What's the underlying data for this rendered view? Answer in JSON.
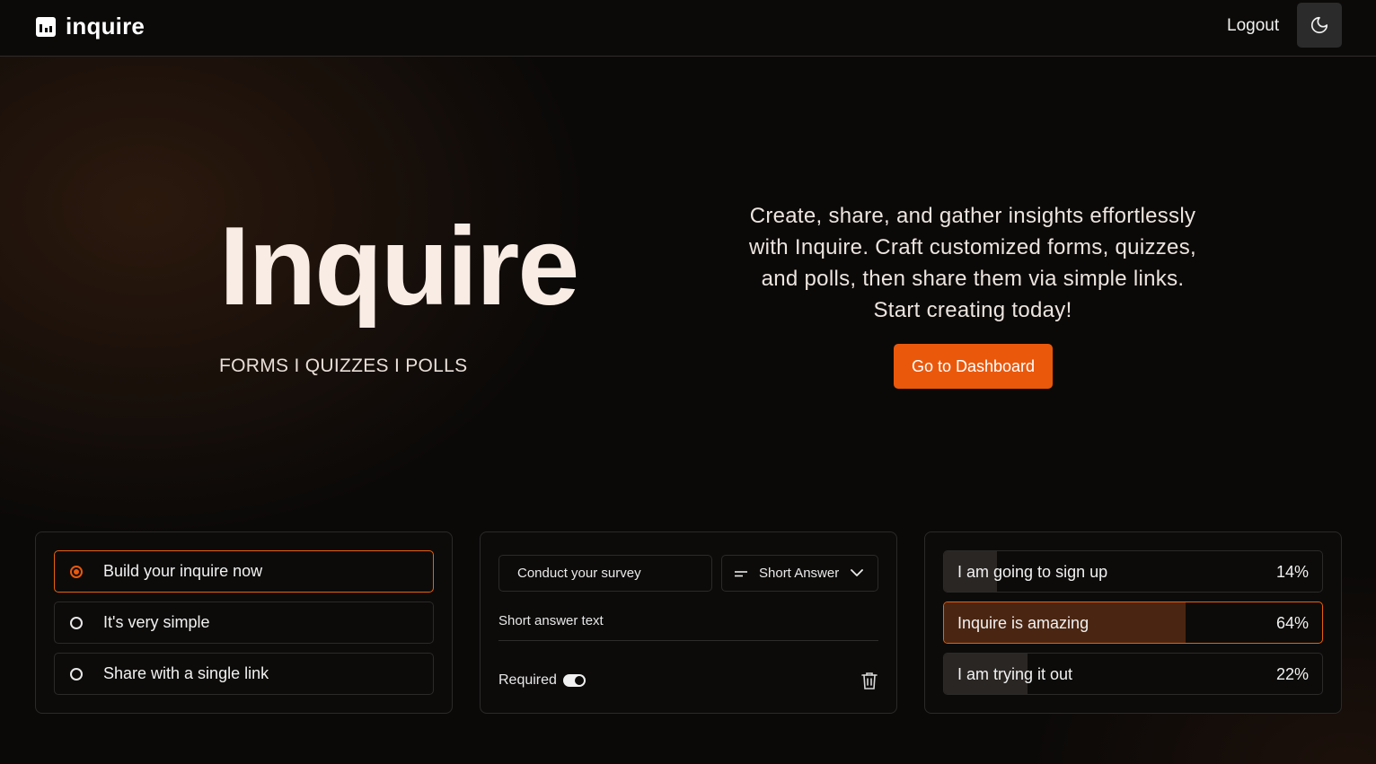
{
  "header": {
    "brand": "inquire",
    "logout_label": "Logout",
    "theme_toggle_icon": "moon-icon"
  },
  "hero": {
    "title": "Inquire",
    "subtitle": "FORMS I QUIZZES I POLLS",
    "description": "Create, share, and gather insights effortlessly with Inquire. Craft customized forms, quizzes, and polls, then share them via simple links. Start creating today!",
    "cta_label": "Go to Dashboard"
  },
  "form_card": {
    "options": [
      {
        "label": "Build your inquire now",
        "selected": true
      },
      {
        "label": "It's very simple",
        "selected": false
      },
      {
        "label": "Share with a single link",
        "selected": false
      }
    ]
  },
  "question_card": {
    "question_value": "Conduct your survey",
    "type_label": "Short Answer",
    "answer_placeholder": "Short answer text",
    "required_label": "Required",
    "required_on": true
  },
  "poll_card": {
    "items": [
      {
        "label": "I am going to sign up",
        "percent_label": "14%",
        "fraction": 0.14,
        "highlighted": false
      },
      {
        "label": "Inquire is amazing",
        "percent_label": "64%",
        "fraction": 0.64,
        "highlighted": true
      },
      {
        "label": "I am trying it out",
        "percent_label": "22%",
        "fraction": 0.22,
        "highlighted": false
      }
    ]
  },
  "colors": {
    "accent": "#ea580c",
    "background": "#0b0908"
  }
}
